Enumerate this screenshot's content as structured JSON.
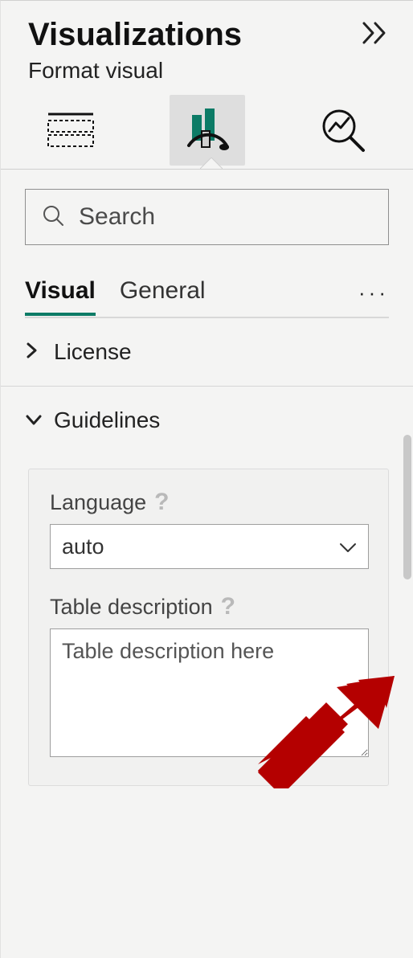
{
  "header": {
    "title": "Visualizations",
    "subtitle": "Format visual"
  },
  "tabs": {
    "fields_icon": "fields-icon",
    "format_icon": "paintbrush-icon",
    "analytics_icon": "analytics-icon"
  },
  "search": {
    "placeholder": "Search"
  },
  "subtabs": {
    "visual": "Visual",
    "general": "General"
  },
  "sections": {
    "license": "License",
    "guidelines": "Guidelines"
  },
  "guidelines": {
    "language_label": "Language",
    "language_value": "auto",
    "table_desc_label": "Table description",
    "table_desc_placeholder": "Table description here"
  }
}
